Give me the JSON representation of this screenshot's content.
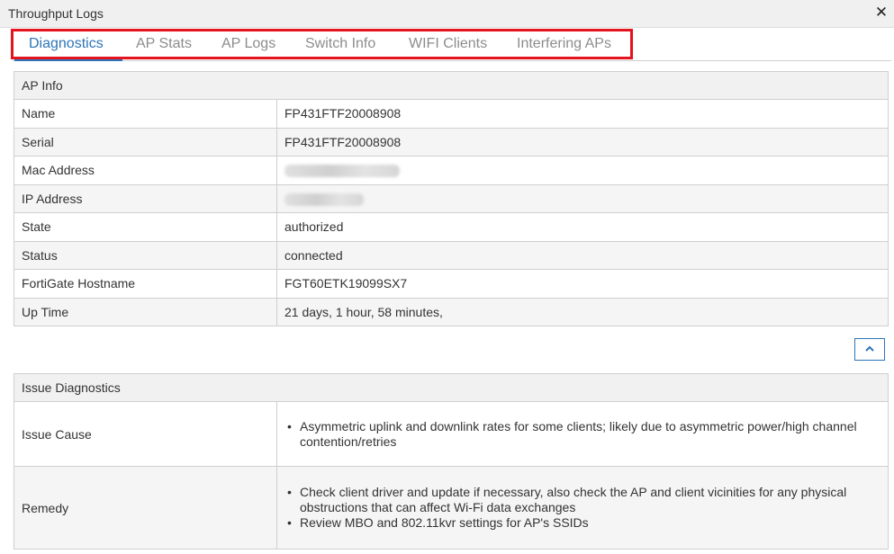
{
  "window": {
    "title": "Throughput Logs",
    "close_icon": "close-icon"
  },
  "tabs": [
    {
      "label": "Diagnostics",
      "active": true
    },
    {
      "label": "AP Stats",
      "active": false
    },
    {
      "label": "AP Logs",
      "active": false
    },
    {
      "label": "Switch Info",
      "active": false
    },
    {
      "label": "WIFI Clients",
      "active": false
    },
    {
      "label": "Interfering APs",
      "active": false
    }
  ],
  "ap_info": {
    "header": "AP Info",
    "rows": [
      {
        "label": "Name",
        "value": "FP431FTF20008908"
      },
      {
        "label": "Serial",
        "value": "FP431FTF20008908"
      },
      {
        "label": "Mac Address",
        "value": ""
      },
      {
        "label": "IP Address",
        "value": ""
      },
      {
        "label": "State",
        "value": "authorized"
      },
      {
        "label": "Status",
        "value": "connected"
      },
      {
        "label": "FortiGate Hostname",
        "value": "FGT60ETK19099SX7"
      },
      {
        "label": "Up Time",
        "value": "21 days, 1 hour, 58 minutes,"
      }
    ]
  },
  "collapse_button": {
    "icon": "chevron-up-icon"
  },
  "issue_diagnostics": {
    "header": "Issue Diagnostics",
    "cause_label": "Issue Cause",
    "cause_items": [
      "Asymmetric uplink and downlink rates for some clients; likely due to asymmetric power/high channel contention/retries"
    ],
    "remedy_label": "Remedy",
    "remedy_items": [
      "Check client driver and update if necessary, also check the AP and client vicinities for any physical obstructions that can affect Wi-Fi data exchanges",
      "Review MBO and 802.11kvr settings for AP's SSIDs"
    ]
  },
  "colors": {
    "accent": "#2d75b8",
    "highlight": "#e3141d",
    "header_bg": "#f1f1f1"
  }
}
